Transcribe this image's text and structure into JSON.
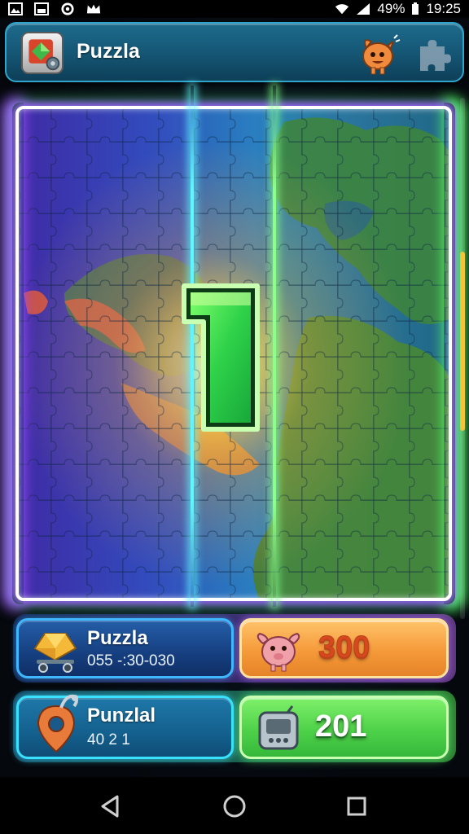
{
  "status_bar": {
    "battery": "49%",
    "time": "19:25",
    "icons": [
      "gallery-icon",
      "image-icon",
      "sync-icon",
      "crown-icon",
      "wifi-icon",
      "signal-icon",
      "battery-icon"
    ]
  },
  "header": {
    "title": "Puzzla",
    "icons": [
      "app-gem-icon",
      "mascot-icon",
      "puzzle-piece-icon"
    ]
  },
  "board": {
    "level_number": "1",
    "frame_colors": {
      "left": "#a14cff",
      "right": "#57ff6a",
      "beam": "#5ff6ff"
    }
  },
  "cards": {
    "row1": {
      "left": {
        "title": "Puzzla",
        "subtitle": "055 -:30-030",
        "icon": "treasure-cart-icon"
      },
      "right": {
        "value": "300",
        "icon": "pig-mascot-icon"
      }
    },
    "row2": {
      "left": {
        "title": "Punzlal",
        "subtitle": "40 2 1",
        "icon": "map-pin-icon"
      },
      "right": {
        "value": "201",
        "icon": "handheld-device-icon"
      }
    }
  },
  "scroll": {
    "position": 0.45
  },
  "nav": {
    "buttons": [
      "back-icon",
      "home-icon",
      "recents-icon"
    ]
  }
}
